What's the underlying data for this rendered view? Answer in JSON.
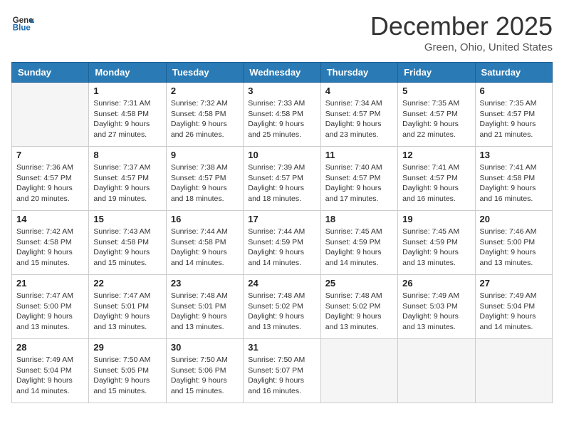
{
  "header": {
    "logo_general": "General",
    "logo_blue": "Blue",
    "month_title": "December 2025",
    "location": "Green, Ohio, United States"
  },
  "calendar": {
    "days_of_week": [
      "Sunday",
      "Monday",
      "Tuesday",
      "Wednesday",
      "Thursday",
      "Friday",
      "Saturday"
    ],
    "weeks": [
      [
        {
          "day": null,
          "date": ""
        },
        {
          "day": 1,
          "sunrise": "7:31 AM",
          "sunset": "4:58 PM",
          "daylight": "9 hours and 27 minutes."
        },
        {
          "day": 2,
          "sunrise": "7:32 AM",
          "sunset": "4:58 PM",
          "daylight": "9 hours and 26 minutes."
        },
        {
          "day": 3,
          "sunrise": "7:33 AM",
          "sunset": "4:58 PM",
          "daylight": "9 hours and 25 minutes."
        },
        {
          "day": 4,
          "sunrise": "7:34 AM",
          "sunset": "4:57 PM",
          "daylight": "9 hours and 23 minutes."
        },
        {
          "day": 5,
          "sunrise": "7:35 AM",
          "sunset": "4:57 PM",
          "daylight": "9 hours and 22 minutes."
        },
        {
          "day": 6,
          "sunrise": "7:35 AM",
          "sunset": "4:57 PM",
          "daylight": "9 hours and 21 minutes."
        }
      ],
      [
        {
          "day": 7,
          "sunrise": "7:36 AM",
          "sunset": "4:57 PM",
          "daylight": "9 hours and 20 minutes."
        },
        {
          "day": 8,
          "sunrise": "7:37 AM",
          "sunset": "4:57 PM",
          "daylight": "9 hours and 19 minutes."
        },
        {
          "day": 9,
          "sunrise": "7:38 AM",
          "sunset": "4:57 PM",
          "daylight": "9 hours and 18 minutes."
        },
        {
          "day": 10,
          "sunrise": "7:39 AM",
          "sunset": "4:57 PM",
          "daylight": "9 hours and 18 minutes."
        },
        {
          "day": 11,
          "sunrise": "7:40 AM",
          "sunset": "4:57 PM",
          "daylight": "9 hours and 17 minutes."
        },
        {
          "day": 12,
          "sunrise": "7:41 AM",
          "sunset": "4:57 PM",
          "daylight": "9 hours and 16 minutes."
        },
        {
          "day": 13,
          "sunrise": "7:41 AM",
          "sunset": "4:58 PM",
          "daylight": "9 hours and 16 minutes."
        }
      ],
      [
        {
          "day": 14,
          "sunrise": "7:42 AM",
          "sunset": "4:58 PM",
          "daylight": "9 hours and 15 minutes."
        },
        {
          "day": 15,
          "sunrise": "7:43 AM",
          "sunset": "4:58 PM",
          "daylight": "9 hours and 15 minutes."
        },
        {
          "day": 16,
          "sunrise": "7:44 AM",
          "sunset": "4:58 PM",
          "daylight": "9 hours and 14 minutes."
        },
        {
          "day": 17,
          "sunrise": "7:44 AM",
          "sunset": "4:59 PM",
          "daylight": "9 hours and 14 minutes."
        },
        {
          "day": 18,
          "sunrise": "7:45 AM",
          "sunset": "4:59 PM",
          "daylight": "9 hours and 14 minutes."
        },
        {
          "day": 19,
          "sunrise": "7:45 AM",
          "sunset": "4:59 PM",
          "daylight": "9 hours and 13 minutes."
        },
        {
          "day": 20,
          "sunrise": "7:46 AM",
          "sunset": "5:00 PM",
          "daylight": "9 hours and 13 minutes."
        }
      ],
      [
        {
          "day": 21,
          "sunrise": "7:47 AM",
          "sunset": "5:00 PM",
          "daylight": "9 hours and 13 minutes."
        },
        {
          "day": 22,
          "sunrise": "7:47 AM",
          "sunset": "5:01 PM",
          "daylight": "9 hours and 13 minutes."
        },
        {
          "day": 23,
          "sunrise": "7:48 AM",
          "sunset": "5:01 PM",
          "daylight": "9 hours and 13 minutes."
        },
        {
          "day": 24,
          "sunrise": "7:48 AM",
          "sunset": "5:02 PM",
          "daylight": "9 hours and 13 minutes."
        },
        {
          "day": 25,
          "sunrise": "7:48 AM",
          "sunset": "5:02 PM",
          "daylight": "9 hours and 13 minutes."
        },
        {
          "day": 26,
          "sunrise": "7:49 AM",
          "sunset": "5:03 PM",
          "daylight": "9 hours and 13 minutes."
        },
        {
          "day": 27,
          "sunrise": "7:49 AM",
          "sunset": "5:04 PM",
          "daylight": "9 hours and 14 minutes."
        }
      ],
      [
        {
          "day": 28,
          "sunrise": "7:49 AM",
          "sunset": "5:04 PM",
          "daylight": "9 hours and 14 minutes."
        },
        {
          "day": 29,
          "sunrise": "7:50 AM",
          "sunset": "5:05 PM",
          "daylight": "9 hours and 15 minutes."
        },
        {
          "day": 30,
          "sunrise": "7:50 AM",
          "sunset": "5:06 PM",
          "daylight": "9 hours and 15 minutes."
        },
        {
          "day": 31,
          "sunrise": "7:50 AM",
          "sunset": "5:07 PM",
          "daylight": "9 hours and 16 minutes."
        },
        {
          "day": null
        },
        {
          "day": null
        },
        {
          "day": null
        }
      ]
    ],
    "labels": {
      "sunrise": "Sunrise:",
      "sunset": "Sunset:",
      "daylight": "Daylight:"
    }
  }
}
